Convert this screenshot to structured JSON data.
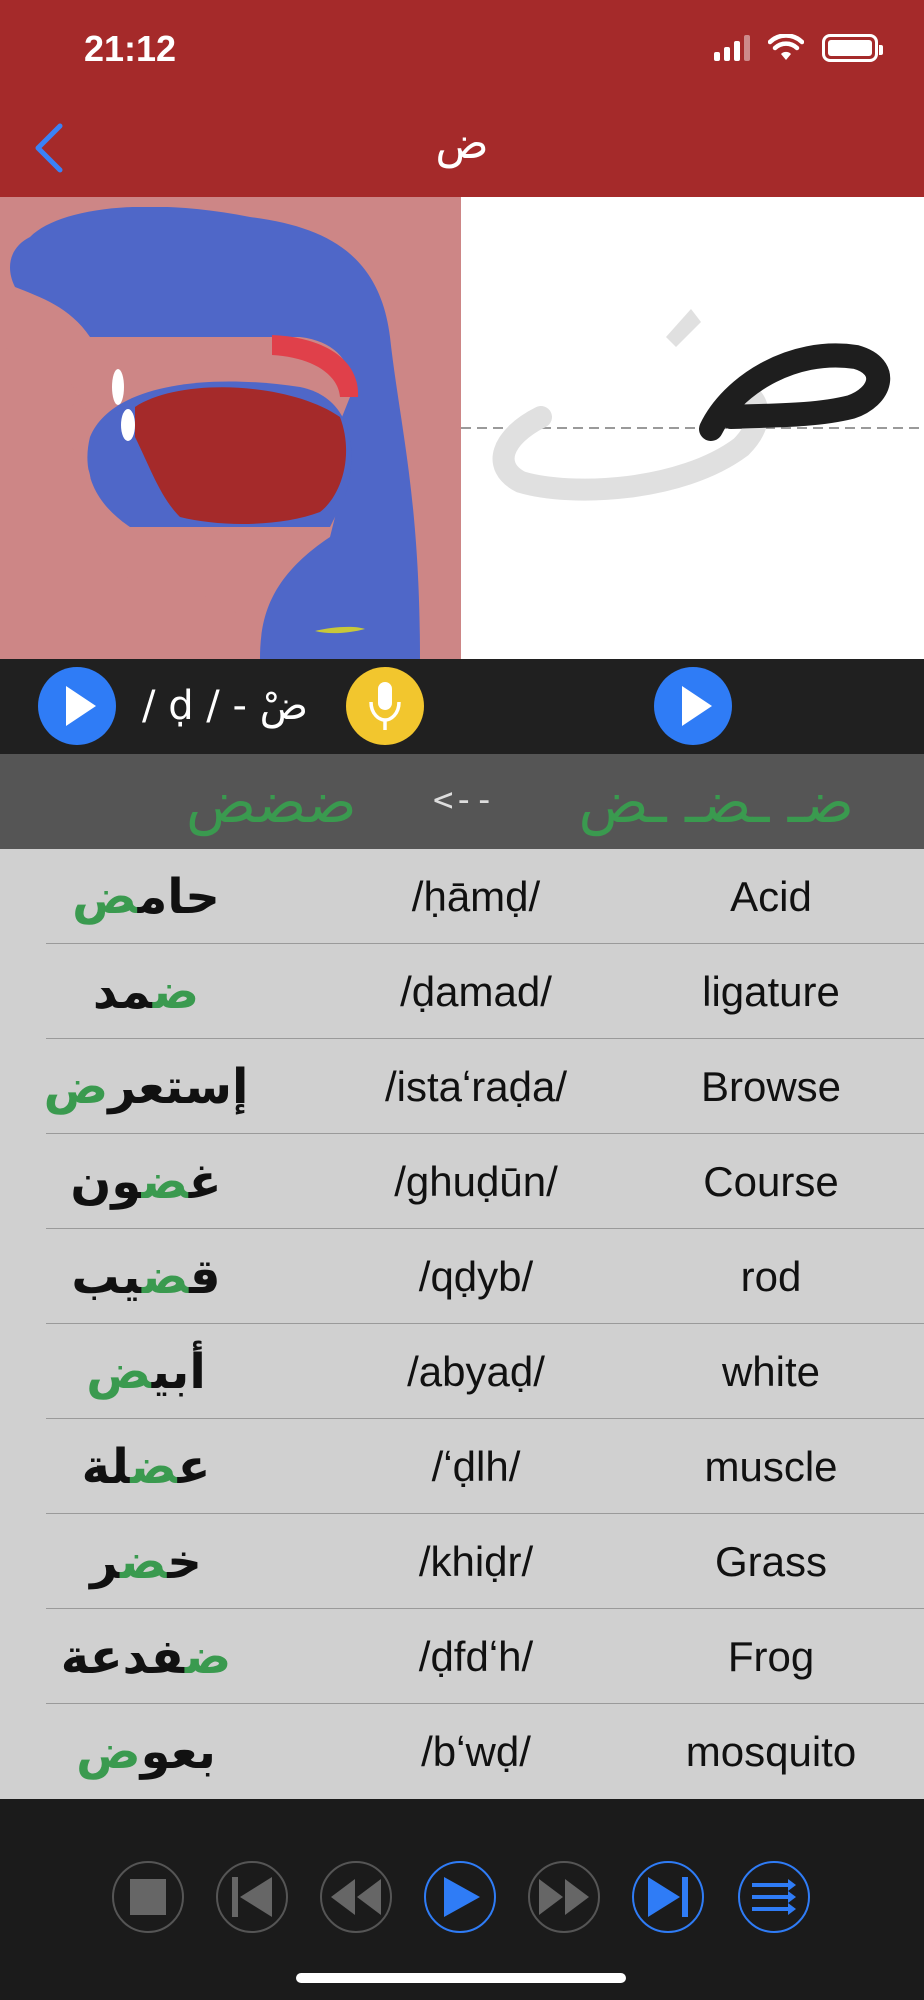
{
  "status": {
    "time": "21:12"
  },
  "header": {
    "title": "ض"
  },
  "playbar": {
    "phoneme_label": "/ ḍ / - ضْ"
  },
  "forms": {
    "isolated_sequence": "ضـ ـضـ ـض",
    "arrow": "<--",
    "joined": "ضضض"
  },
  "words": [
    {
      "arabic_pre": "حام",
      "arabic_hl": "ض",
      "arabic_post": "",
      "translit": "/ḥāmḍ/",
      "english": "Acid"
    },
    {
      "arabic_pre": "",
      "arabic_hl": "ض",
      "arabic_post": "مد",
      "translit": "/ḍamad/",
      "english": "ligature"
    },
    {
      "arabic_pre": "إستعر",
      "arabic_hl": "ض",
      "arabic_post": "",
      "translit": "/istaʻraḍa/",
      "english": "Browse"
    },
    {
      "arabic_pre": "غ",
      "arabic_hl": "ض",
      "arabic_post": "ون",
      "translit": "/ghuḍūn/",
      "english": "Course"
    },
    {
      "arabic_pre": "ق",
      "arabic_hl": "ض",
      "arabic_post": "يب",
      "translit": "/qḍyb/",
      "english": "rod"
    },
    {
      "arabic_pre": "أبي",
      "arabic_hl": "ض",
      "arabic_post": "",
      "translit": "/abyaḍ/",
      "english": "white"
    },
    {
      "arabic_pre": "ع",
      "arabic_hl": "ض",
      "arabic_post": "لة",
      "translit": "/ʻḍlh/",
      "english": "muscle"
    },
    {
      "arabic_pre": "خ",
      "arabic_hl": "ض",
      "arabic_post": "ر",
      "translit": "/khiḍr/",
      "english": "Grass"
    },
    {
      "arabic_pre": "",
      "arabic_hl": "ض",
      "arabic_post": "فدعة",
      "translit": "/ḍfdʻh/",
      "english": "Frog"
    },
    {
      "arabic_pre": "بعو",
      "arabic_hl": "ض",
      "arabic_post": "",
      "translit": "/bʻwḍ/",
      "english": "mosquito"
    }
  ],
  "colors": {
    "header": "#a52a2a",
    "accent_green": "#3a9a4f",
    "accent_blue": "#2f7cf6",
    "mic_yellow": "#f2c62e"
  },
  "icons": {
    "toolbar": [
      "stop-icon",
      "skip-to-start-icon",
      "rewind-icon",
      "play-icon",
      "fast-forward-icon",
      "skip-to-end-icon",
      "list-icon"
    ]
  }
}
